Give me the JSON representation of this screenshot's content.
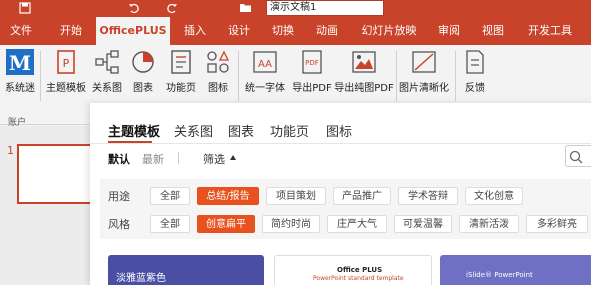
{
  "window": {
    "doc_title": "演示文稿1",
    "quick_access": [
      "save-icon",
      "undo-icon",
      "redo-icon",
      "folder-icon"
    ]
  },
  "menu": {
    "tabs": [
      "文件",
      "开始",
      "OfficePLUS",
      "插入",
      "设计",
      "切换",
      "动画",
      "幻灯片放映",
      "审阅",
      "视图",
      "开发工具"
    ],
    "active": "OfficePLUS"
  },
  "ribbon": {
    "buttons": [
      {
        "label": "系统迷",
        "icon": "officeplus-logo-icon"
      },
      {
        "label": "主题模板",
        "icon": "theme-template-icon"
      },
      {
        "label": "关系图",
        "icon": "relation-diagram-icon"
      },
      {
        "label": "图表",
        "icon": "chart-icon"
      },
      {
        "label": "功能页",
        "icon": "function-page-icon"
      },
      {
        "label": "图标",
        "icon": "icons-icon"
      },
      {
        "label": "统一字体",
        "icon": "unify-font-icon"
      },
      {
        "label": "导出PDF",
        "icon": "export-pdf-icon"
      },
      {
        "label": "导出纯图PDF",
        "icon": "export-image-pdf-icon"
      },
      {
        "label": "图片清晰化",
        "icon": "image-sharpen-icon"
      },
      {
        "label": "反馈",
        "icon": "feedback-icon"
      }
    ],
    "group_label": "账户"
  },
  "slides": {
    "number": "1"
  },
  "panel": {
    "tabs": [
      "主题模板",
      "关系图",
      "图表",
      "功能页",
      "图标"
    ],
    "active_tab": "主题模板",
    "sort": [
      "默认",
      "最新"
    ],
    "filter_label": "筛选",
    "usage_label": "用途",
    "usage": [
      "全部",
      "总结/报告",
      "项目策划",
      "产品推广",
      "学术答辩",
      "文化创意"
    ],
    "usage_selected": "总结/报告",
    "style_label": "风格",
    "style": [
      "全部",
      "创意扁平",
      "简约时尚",
      "庄严大气",
      "可爱温馨",
      "清新活泼",
      "多彩鲜亮"
    ],
    "style_selected": "创意扁平",
    "cards": [
      {
        "title": "淡雅蓝紫色",
        "bg": "#4a4fa3"
      },
      {
        "title": "Office PLUS",
        "subtitle": "PowerPoint standard template",
        "bg": "#ffffff"
      },
      {
        "title": "iSlide® PowerPoint",
        "bg": "#6f6fc4"
      }
    ]
  },
  "colors": {
    "accent": "#c9432a",
    "chip_selected": "#e8521f"
  }
}
